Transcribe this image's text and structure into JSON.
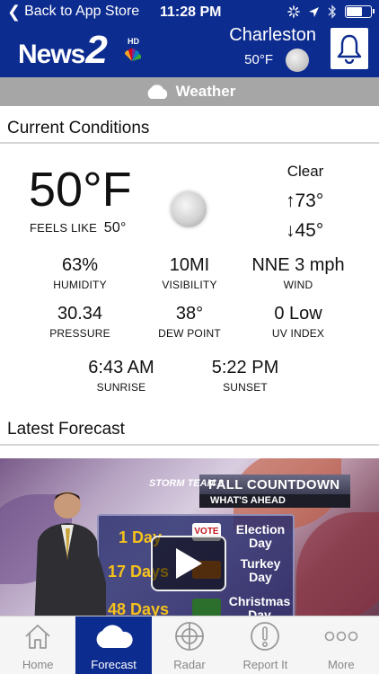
{
  "status_bar": {
    "back_label": "Back to App Store",
    "time": "11:28 PM",
    "battery_level": 0.6
  },
  "header": {
    "logo_text": "News",
    "logo_number": "2",
    "logo_hd": "HD",
    "city": "Charleston",
    "temp": "50°F",
    "brand_color": "#0d2c8f"
  },
  "weather_bar": {
    "label": "Weather"
  },
  "current_conditions": {
    "title": "Current Conditions",
    "temp": "50°F",
    "feels_like_label": "FEELS LIKE",
    "feels_like_value": "50°",
    "condition": "Clear",
    "high": "↑73°",
    "low": "↓45°",
    "stats": [
      {
        "value": "63%",
        "label": "HUMIDITY"
      },
      {
        "value": "10MI",
        "label": "VISIBILITY"
      },
      {
        "value": "NNE 3 mph",
        "label": "WIND"
      },
      {
        "value": "30.34",
        "label": "PRESSURE"
      },
      {
        "value": "38°",
        "label": "DEW POINT"
      },
      {
        "value": "0 Low",
        "label": "UV INDEX"
      },
      {
        "value": "6:43 AM",
        "label": "SUNRISE"
      },
      {
        "value": "5:22 PM",
        "label": "SUNSET"
      }
    ]
  },
  "latest_forecast": {
    "title": "Latest Forecast",
    "video": {
      "badge": "STORM TEAM 2",
      "headline": "FALL COUNTDOWN",
      "subhead": "WHAT'S AHEAD",
      "rows": [
        {
          "days": "1 Day",
          "event": "Election Day",
          "icon_label": "VOTE"
        },
        {
          "days": "17 Days",
          "event": "Turkey Day"
        },
        {
          "days": "48 Days",
          "event": "Christmas Day"
        }
      ]
    }
  },
  "tabs": [
    {
      "label": "Home",
      "icon": "home-icon",
      "active": false
    },
    {
      "label": "Forecast",
      "icon": "cloud-icon",
      "active": true
    },
    {
      "label": "Radar",
      "icon": "radar-icon",
      "active": false
    },
    {
      "label": "Report It",
      "icon": "alert-circle-icon",
      "active": false
    },
    {
      "label": "More",
      "icon": "more-icon",
      "active": false
    }
  ]
}
